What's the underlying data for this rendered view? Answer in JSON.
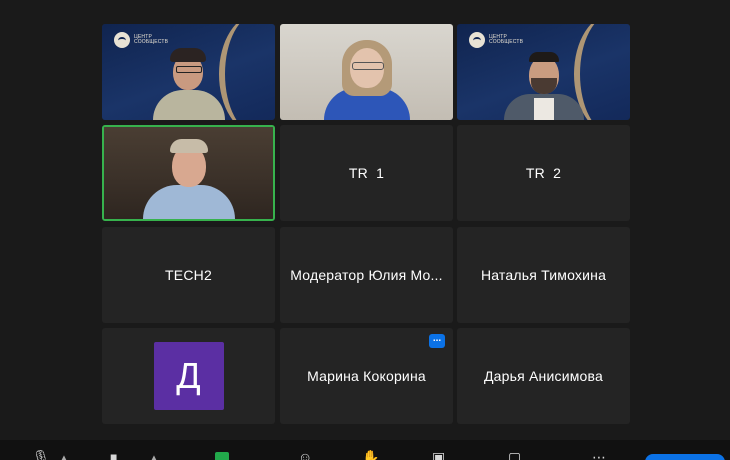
{
  "gallery": {
    "tiles": [
      {
        "name": "",
        "type": "video",
        "logo": "ЦЕНТР СООБЩЕСТВ"
      },
      {
        "name": "",
        "type": "video"
      },
      {
        "name": "",
        "type": "video",
        "logo": "ЦЕНТР СООБЩЕСТВ"
      },
      {
        "name": "",
        "type": "video",
        "active_speaker": true
      },
      {
        "name": "TR  1",
        "type": "name-only"
      },
      {
        "name": "TR  2",
        "type": "name-only"
      },
      {
        "name": "TECH2",
        "type": "name-only"
      },
      {
        "name": "Модератор Юлия Мо...",
        "type": "name-only"
      },
      {
        "name": "Наталья Тимохина",
        "type": "name-only"
      },
      {
        "name": "",
        "type": "avatar",
        "avatar_letter": "Д",
        "avatar_color": "#5b2fa3"
      },
      {
        "name": "Марина Кокорина",
        "type": "name-only",
        "more_menu": "..."
      },
      {
        "name": "Дарья Анисимова",
        "type": "name-only"
      }
    ]
  },
  "toolbar": {
    "icons": [
      "mic-muted-icon",
      "video-camera-icon",
      "share-screen-icon",
      "participants-icon",
      "reactions-icon",
      "apps-icon",
      "whiteboard-icon",
      "more-icon"
    ]
  },
  "colors": {
    "background": "#1a1a1a",
    "tile": "#242424",
    "active_border": "#37b24d",
    "accent": "#0b72e7"
  }
}
